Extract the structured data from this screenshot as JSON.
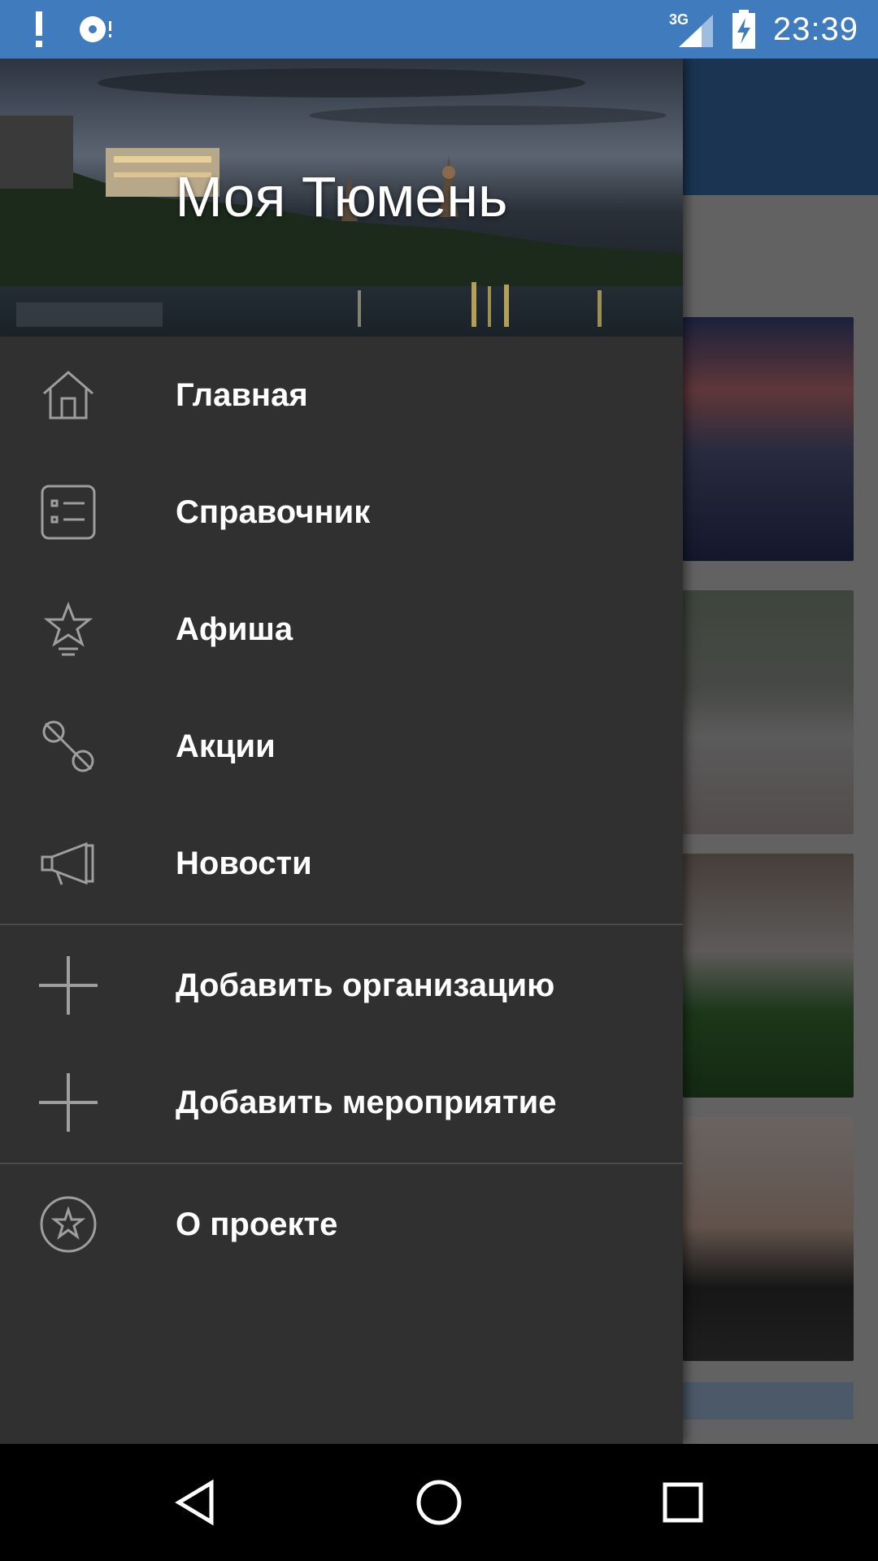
{
  "status_bar": {
    "time": "23:39",
    "network": "3G",
    "icons": [
      "alert-icon",
      "sync-disc-icon",
      "signal-icon",
      "battery-charging-icon"
    ]
  },
  "drawer": {
    "header_title": "Моя Тюмень",
    "primary_items": [
      {
        "label": "Главная",
        "icon": "home-icon"
      },
      {
        "label": "Справочник",
        "icon": "directory-list-icon"
      },
      {
        "label": "Афиша",
        "icon": "star-poster-icon"
      },
      {
        "label": "Акции",
        "icon": "percent-icon"
      },
      {
        "label": "Новости",
        "icon": "megaphone-icon"
      }
    ],
    "secondary_items": [
      {
        "label": "Добавить организацию",
        "icon": "plus-icon"
      },
      {
        "label": "Добавить мероприятие",
        "icon": "plus-icon"
      }
    ],
    "footer_items": [
      {
        "label": "О проекте",
        "icon": "star-circle-icon"
      }
    ]
  },
  "colors": {
    "status_bar": "#3f7bbd",
    "drawer_bg": "#303030",
    "divider": "#4a4a4a",
    "icon": "#9e9e9e"
  },
  "nav_bar": {
    "buttons": [
      "back-icon",
      "home-circle-icon",
      "recents-icon"
    ]
  }
}
